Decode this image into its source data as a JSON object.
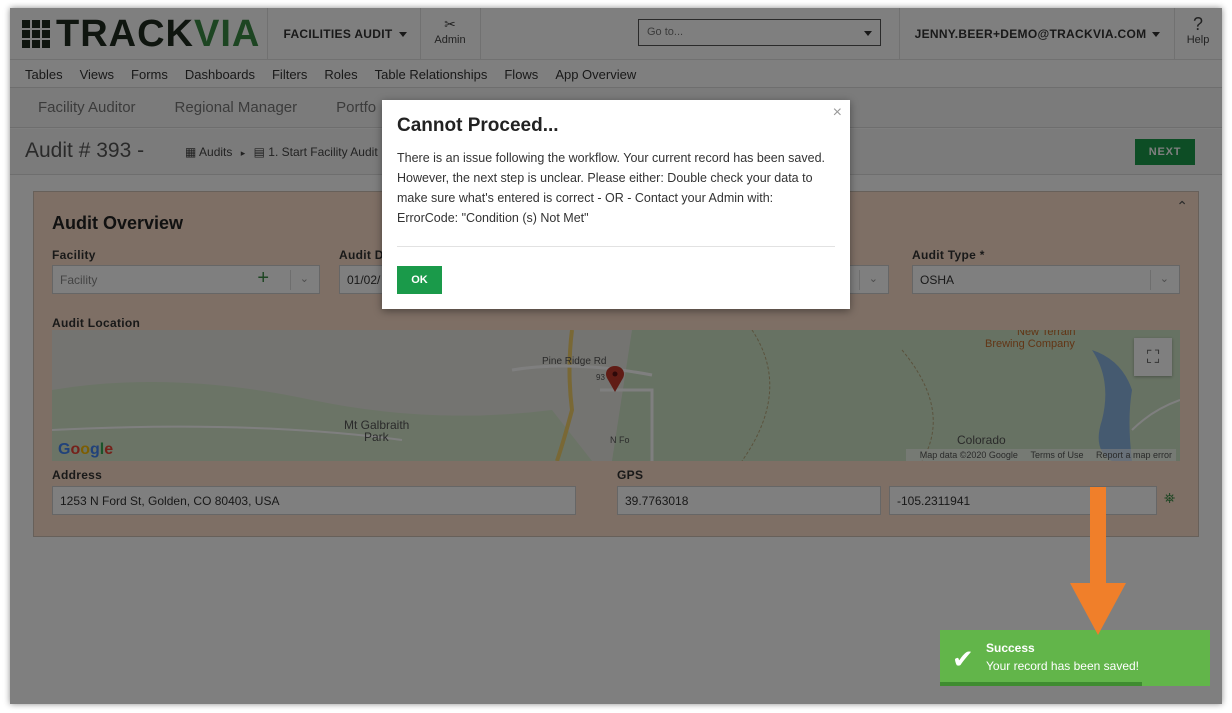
{
  "topbar": {
    "logo_track": "TRACK",
    "logo_via": "VIA",
    "app_name": "FACILITIES AUDIT",
    "admin_label": "Admin",
    "goto_placeholder": "Go to...",
    "user": "JENNY.BEER+DEMO@TRACKVIA.COM",
    "help_label": "Help",
    "help_icon": "?"
  },
  "admin_nav": [
    "Tables",
    "Views",
    "Forms",
    "Dashboards",
    "Filters",
    "Roles",
    "Table Relationships",
    "Flows",
    "App Overview"
  ],
  "role_tabs": [
    "Facility Auditor",
    "Regional Manager",
    "Portfo"
  ],
  "record": {
    "title": "Audit # 393 -",
    "crumb_1": "Audits",
    "crumb_2": "1. Start Facility Audit",
    "next_label": "NEXT"
  },
  "panel": {
    "title": "Audit Overview",
    "facility_label": "Facility",
    "facility_placeholder": "Facility",
    "audit_date_label": "Audit D",
    "audit_date_value": "01/02/",
    "audit_type_label": "Audit Type *",
    "audit_type_value": "OSHA",
    "location_label": "Audit Location",
    "address_label": "Address",
    "address_value": "1253 N Ford St, Golden, CO 80403, USA",
    "gps_label": "GPS",
    "gps_lat": "39.7763018",
    "gps_lng": "-105.2311941"
  },
  "map": {
    "labels": [
      "Pine Ridge Rd",
      "Mt Galbraith",
      "Park",
      "New Terrain",
      "Brewing Company",
      "Colorado",
      "N Fo",
      "93"
    ],
    "google": "Google",
    "map_data": "Map data ©2020 Google",
    "terms": "Terms of Use",
    "report": "Report a map error"
  },
  "modal": {
    "title": "Cannot Proceed...",
    "body": "There is an issue following the workflow. Your current record has been saved. However, the next step is unclear. Please either: Double check your data to make sure what's entered is correct - OR - Contact your Admin with: ErrorCode: \"Condition (s) Not Met\"",
    "ok_label": "OK",
    "close_icon": "×"
  },
  "toast": {
    "title": "Success",
    "message": "Your record has been saved!"
  },
  "colors": {
    "brand_green": "#1a9a4a",
    "toast_green": "#62b54a",
    "panel_bg": "#fcdfca",
    "arrow_orange": "#f07f2a"
  }
}
